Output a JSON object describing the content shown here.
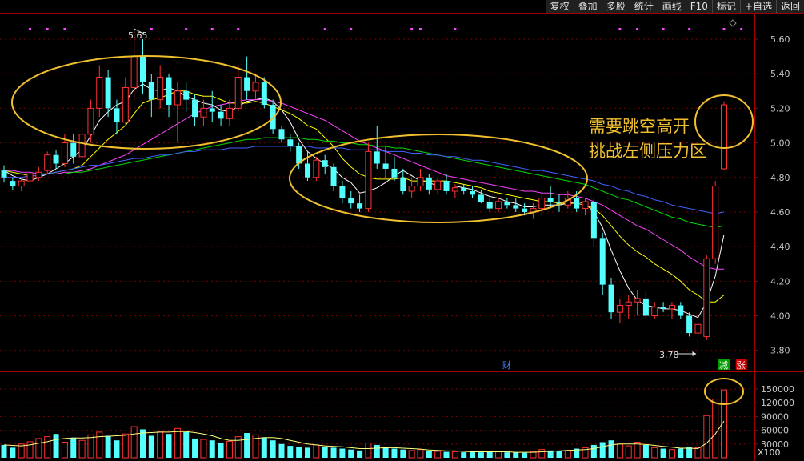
{
  "toolbar": {
    "buttons": [
      "复权",
      "叠加",
      "多股",
      "统计",
      "画线",
      "F10",
      "标记",
      "+自选",
      "返回"
    ]
  },
  "colors": {
    "up": "#ff3232",
    "down": "#54ffff",
    "flat": "#ffffff",
    "ma5": "#ffffff",
    "ma10": "#ffff00",
    "ma20": "#ff44ff",
    "ma30": "#00dd00",
    "ma60": "#4060ff",
    "annotation": "#f0c030",
    "grid": "#7a0000",
    "axis_text": "#c8c8c8",
    "marker": "#ff44ff"
  },
  "chart_data": [
    {
      "type": "candlestick",
      "ylim": [
        3.7,
        5.7
      ],
      "y_ticks": [
        "5.60",
        "5.40",
        "5.20",
        "5.00",
        "4.80",
        "4.60",
        "4.40",
        "4.20",
        "4.00",
        "3.80"
      ],
      "ohlc": [
        [
          4.84,
          4.87,
          4.77,
          4.8
        ],
        [
          4.78,
          4.8,
          4.73,
          4.75
        ],
        [
          4.75,
          4.8,
          4.72,
          4.78
        ],
        [
          4.78,
          4.85,
          4.76,
          4.82
        ],
        [
          4.8,
          4.86,
          4.78,
          4.83
        ],
        [
          4.84,
          4.95,
          4.82,
          4.93
        ],
        [
          4.93,
          4.96,
          4.85,
          4.88
        ],
        [
          4.88,
          5.05,
          4.86,
          5.0
        ],
        [
          5.0,
          5.05,
          4.88,
          4.92
        ],
        [
          4.92,
          5.1,
          4.9,
          5.05
        ],
        [
          5.05,
          5.25,
          5.0,
          5.2
        ],
        [
          5.2,
          5.45,
          5.15,
          5.38
        ],
        [
          5.38,
          5.42,
          5.15,
          5.2
        ],
        [
          5.2,
          5.25,
          5.05,
          5.12
        ],
        [
          5.12,
          5.38,
          5.1,
          5.32
        ],
        [
          5.32,
          5.66,
          5.25,
          5.5
        ],
        [
          5.5,
          5.6,
          5.28,
          5.35
        ],
        [
          5.35,
          5.4,
          5.15,
          5.25
        ],
        [
          5.25,
          5.45,
          5.2,
          5.38
        ],
        [
          5.38,
          5.4,
          5.15,
          5.22
        ],
        [
          5.22,
          5.35,
          5.0,
          5.3
        ],
        [
          5.3,
          5.35,
          5.18,
          5.25
        ],
        [
          5.25,
          5.28,
          5.1,
          5.15
        ],
        [
          5.15,
          5.25,
          5.1,
          5.2
        ],
        [
          5.2,
          5.3,
          5.12,
          5.18
        ],
        [
          5.18,
          5.22,
          5.1,
          5.14
        ],
        [
          5.14,
          5.25,
          5.1,
          5.2
        ],
        [
          5.2,
          5.45,
          5.18,
          5.38
        ],
        [
          5.38,
          5.5,
          5.25,
          5.3
        ],
        [
          5.3,
          5.4,
          5.25,
          5.35
        ],
        [
          5.35,
          5.38,
          5.2,
          5.22
        ],
        [
          5.22,
          5.25,
          5.05,
          5.08
        ],
        [
          5.08,
          5.1,
          5.0,
          5.02
        ],
        [
          5.02,
          5.05,
          4.95,
          4.98
        ],
        [
          4.98,
          5.0,
          4.85,
          4.88
        ],
        [
          4.88,
          4.95,
          4.78,
          4.8
        ],
        [
          4.8,
          4.92,
          4.78,
          4.9
        ],
        [
          4.9,
          4.93,
          4.82,
          4.86
        ],
        [
          4.86,
          4.88,
          4.72,
          4.75
        ],
        [
          4.75,
          4.78,
          4.65,
          4.68
        ],
        [
          4.68,
          4.72,
          4.62,
          4.65
        ],
        [
          4.65,
          4.7,
          4.6,
          4.62
        ],
        [
          4.62,
          5.0,
          4.6,
          4.95
        ],
        [
          4.95,
          5.1,
          4.85,
          4.88
        ],
        [
          4.88,
          4.98,
          4.8,
          4.85
        ],
        [
          4.85,
          4.92,
          4.78,
          4.8
        ],
        [
          4.8,
          4.85,
          4.7,
          4.72
        ],
        [
          4.72,
          4.8,
          4.68,
          4.75
        ],
        [
          4.75,
          4.85,
          4.72,
          4.8
        ],
        [
          4.8,
          4.82,
          4.7,
          4.73
        ],
        [
          4.73,
          4.8,
          4.7,
          4.78
        ],
        [
          4.78,
          4.82,
          4.7,
          4.72
        ],
        [
          4.72,
          4.76,
          4.68,
          4.74
        ],
        [
          4.74,
          4.76,
          4.7,
          4.72
        ],
        [
          4.72,
          4.75,
          4.68,
          4.7
        ],
        [
          4.7,
          4.73,
          4.65,
          4.66
        ],
        [
          4.66,
          4.68,
          4.6,
          4.62
        ],
        [
          4.62,
          4.68,
          4.6,
          4.66
        ],
        [
          4.66,
          4.68,
          4.62,
          4.64
        ],
        [
          4.64,
          4.68,
          4.6,
          4.62
        ],
        [
          4.62,
          4.65,
          4.58,
          4.6
        ],
        [
          4.6,
          4.65,
          4.56,
          4.62
        ],
        [
          4.62,
          4.72,
          4.58,
          4.68
        ],
        [
          4.68,
          4.75,
          4.62,
          4.66
        ],
        [
          4.66,
          4.7,
          4.6,
          4.64
        ],
        [
          4.64,
          4.72,
          4.62,
          4.68
        ],
        [
          4.68,
          4.72,
          4.6,
          4.62
        ],
        [
          4.62,
          4.68,
          4.58,
          4.66
        ],
        [
          4.66,
          4.68,
          4.4,
          4.45
        ],
        [
          4.45,
          4.48,
          4.12,
          4.18
        ],
        [
          4.18,
          4.22,
          3.98,
          4.02
        ],
        [
          4.02,
          4.1,
          3.96,
          4.06
        ],
        [
          4.06,
          4.12,
          3.98,
          4.08
        ],
        [
          4.08,
          4.15,
          4.0,
          4.1
        ],
        [
          4.1,
          4.14,
          3.98,
          4.0
        ],
        [
          4.0,
          4.08,
          3.98,
          4.05
        ],
        [
          4.05,
          4.08,
          4.02,
          4.04
        ],
        [
          4.04,
          4.08,
          3.98,
          4.06
        ],
        [
          4.06,
          4.08,
          3.98,
          4.0
        ],
        [
          4.0,
          4.02,
          3.88,
          3.9
        ],
        [
          3.9,
          3.98,
          3.78,
          3.95
        ],
        [
          3.88,
          4.35,
          3.86,
          4.33
        ],
        [
          4.33,
          4.78,
          4.3,
          4.75
        ],
        [
          4.85,
          5.24,
          4.84,
          5.22
        ]
      ],
      "ma": [
        {
          "name": "MA5",
          "values": [
            4.84,
            4.81,
            4.79,
            4.78,
            4.8,
            4.82,
            4.85,
            4.88,
            4.92,
            4.96,
            5.04,
            5.13,
            5.18,
            5.22,
            5.24,
            5.31,
            5.34,
            5.31,
            5.3,
            5.32,
            5.3,
            5.27,
            5.25,
            5.23,
            5.22,
            5.19,
            5.18,
            5.21,
            5.24,
            5.25,
            5.26,
            5.24,
            5.19,
            5.12,
            5.02,
            4.95,
            4.91,
            4.88,
            4.85,
            4.8,
            4.77,
            4.71,
            4.72,
            4.74,
            4.77,
            4.81,
            4.84,
            4.81,
            4.78,
            4.77,
            4.75,
            4.75,
            4.75,
            4.74,
            4.73,
            4.71,
            4.69,
            4.68,
            4.66,
            4.65,
            4.63,
            4.63,
            4.64,
            4.64,
            4.64,
            4.65,
            4.66,
            4.65,
            4.6,
            4.51,
            4.38,
            4.26,
            4.16,
            4.09,
            4.06,
            4.05,
            4.04,
            4.04,
            4.03,
            4.01,
            3.99,
            4.08,
            4.23,
            4.47
          ]
        },
        {
          "name": "MA10",
          "values": [
            4.84,
            4.83,
            4.82,
            4.81,
            4.81,
            4.82,
            4.83,
            4.84,
            4.85,
            4.87,
            4.92,
            4.97,
            5.02,
            5.06,
            5.1,
            5.17,
            5.23,
            5.25,
            5.26,
            5.28,
            5.3,
            5.3,
            5.28,
            5.27,
            5.27,
            5.25,
            5.23,
            5.23,
            5.23,
            5.24,
            5.23,
            5.21,
            5.19,
            5.17,
            5.14,
            5.1,
            5.08,
            5.03,
            4.98,
            4.91,
            4.86,
            4.82,
            4.8,
            4.79,
            4.79,
            4.79,
            4.8,
            4.78,
            4.78,
            4.78,
            4.78,
            4.78,
            4.77,
            4.76,
            4.75,
            4.74,
            4.72,
            4.71,
            4.7,
            4.69,
            4.68,
            4.67,
            4.66,
            4.66,
            4.65,
            4.65,
            4.65,
            4.64,
            4.62,
            4.58,
            4.52,
            4.46,
            4.41,
            4.37,
            4.34,
            4.3,
            4.27,
            4.24,
            4.2,
            4.15,
            4.12,
            4.08,
            4.08,
            4.12
          ]
        },
        {
          "name": "MA20",
          "values": [
            4.84,
            4.84,
            4.83,
            4.83,
            4.82,
            4.82,
            4.82,
            4.83,
            4.83,
            4.84,
            4.85,
            4.87,
            4.89,
            4.91,
            4.93,
            4.96,
            4.99,
            5.02,
            5.05,
            5.08,
            5.11,
            5.14,
            5.17,
            5.19,
            5.21,
            5.22,
            5.23,
            5.24,
            5.25,
            5.25,
            5.25,
            5.24,
            5.23,
            5.21,
            5.19,
            5.17,
            5.15,
            5.13,
            5.1,
            5.07,
            5.04,
            5.01,
            4.99,
            4.97,
            4.95,
            4.93,
            4.91,
            4.89,
            4.87,
            4.85,
            4.83,
            4.81,
            4.8,
            4.79,
            4.78,
            4.77,
            4.76,
            4.75,
            4.74,
            4.73,
            4.72,
            4.72,
            4.71,
            4.71,
            4.7,
            4.7,
            4.69,
            4.68,
            4.66,
            4.64,
            4.61,
            4.58,
            4.55,
            4.52,
            4.5,
            4.47,
            4.44,
            4.41,
            4.38,
            4.34,
            4.31,
            4.28,
            4.27,
            4.27
          ]
        },
        {
          "name": "MA30",
          "values": [
            4.82,
            4.82,
            4.82,
            4.82,
            4.82,
            4.82,
            4.82,
            4.82,
            4.83,
            4.83,
            4.84,
            4.85,
            4.86,
            4.87,
            4.88,
            4.89,
            4.9,
            4.91,
            4.92,
            4.93,
            4.94,
            4.95,
            4.96,
            4.97,
            4.98,
            4.99,
            5.0,
            5.01,
            5.02,
            5.02,
            5.03,
            5.03,
            5.03,
            5.03,
            5.03,
            5.02,
            5.02,
            5.01,
            5.01,
            5.0,
            5.0,
            4.99,
            4.99,
            4.98,
            4.98,
            4.97,
            4.97,
            4.96,
            4.95,
            4.94,
            4.93,
            4.92,
            4.91,
            4.9,
            4.89,
            4.88,
            4.87,
            4.86,
            4.85,
            4.84,
            4.83,
            4.82,
            4.81,
            4.8,
            4.79,
            4.78,
            4.77,
            4.76,
            4.74,
            4.72,
            4.7,
            4.68,
            4.67,
            4.65,
            4.63,
            4.61,
            4.59,
            4.57,
            4.56,
            4.54,
            4.53,
            4.52,
            4.51,
            4.52
          ]
        },
        {
          "name": "MA60",
          "values": [
            4.8,
            4.8,
            4.8,
            4.81,
            4.81,
            4.82,
            4.83,
            4.84,
            4.85,
            4.86,
            4.87,
            4.87,
            4.88,
            4.89,
            4.9,
            4.91,
            4.91,
            4.92,
            4.93,
            4.93,
            4.94,
            4.95,
            4.95,
            4.96,
            4.96,
            4.96,
            4.97,
            4.97,
            4.97,
            4.98,
            4.98,
            4.98,
            4.98,
            4.98,
            4.98,
            4.98,
            4.97,
            4.97,
            4.97,
            4.97,
            4.96,
            4.96,
            4.96,
            4.96,
            4.95,
            4.95,
            4.95,
            4.94,
            4.94,
            4.93,
            4.93,
            4.92,
            4.92,
            4.91,
            4.9,
            4.9,
            4.89,
            4.88,
            4.87,
            4.86,
            4.85,
            4.84,
            4.84,
            4.83,
            4.82,
            4.81,
            4.8,
            4.79,
            4.78,
            4.76,
            4.75,
            4.73,
            4.72,
            4.7,
            4.69,
            4.67,
            4.66,
            4.64,
            4.63,
            4.62,
            4.61,
            4.6,
            4.59,
            4.6
          ]
        }
      ],
      "high_label": "5.65",
      "low_label": "3.78",
      "event_labels": [
        {
          "text": "财",
          "index": 58
        },
        {
          "text": "减",
          "index": 83
        },
        {
          "text": "涨",
          "index": 85
        }
      ],
      "annotations": {
        "text_line1": "需要跳空高开",
        "text_line2": "挑战左侧压力区"
      }
    },
    {
      "type": "bar",
      "ylim": [
        0,
        165000
      ],
      "y_ticks": [
        "150000",
        "120000",
        "90000",
        "60000",
        "30000"
      ],
      "unit_label": "X100",
      "volume": [
        28000,
        22000,
        30000,
        35000,
        42000,
        46000,
        52000,
        34000,
        44000,
        38000,
        50000,
        56000,
        48000,
        38000,
        52000,
        68000,
        62000,
        48000,
        58000,
        52000,
        64000,
        56000,
        42000,
        40000,
        38000,
        32000,
        36000,
        46000,
        54000,
        50000,
        44000,
        38000,
        30000,
        26000,
        24000,
        22000,
        28000,
        24000,
        22000,
        20000,
        18000,
        16000,
        32000,
        28000,
        24000,
        20000,
        18000,
        16000,
        18000,
        15000,
        14000,
        13000,
        13000,
        12000,
        13000,
        12000,
        14000,
        13000,
        12000,
        12000,
        11000,
        14000,
        18000,
        16000,
        14000,
        16000,
        20000,
        22000,
        28000,
        34000,
        38000,
        30000,
        26000,
        34000,
        28000,
        22000,
        20000,
        18000,
        20000,
        24000,
        22000,
        92000,
        128000,
        148000
      ],
      "ma_volume": [
        28000,
        27000,
        26000,
        28000,
        32000,
        35000,
        40000,
        42000,
        43000,
        43000,
        44000,
        46000,
        47000,
        48000,
        49000,
        52000,
        54000,
        55000,
        56000,
        56000,
        57000,
        57000,
        55000,
        52000,
        48000,
        42000,
        38000,
        38000,
        40000,
        42000,
        44000,
        44000,
        42000,
        38000,
        34000,
        30000,
        28000,
        26000,
        25000,
        24000,
        22000,
        20000,
        20000,
        21000,
        22000,
        22000,
        21000,
        20000,
        19000,
        17000,
        16000,
        15000,
        15000,
        14000,
        13000,
        13000,
        13000,
        13000,
        13000,
        12000,
        12000,
        12000,
        13000,
        14000,
        15000,
        16000,
        17000,
        18000,
        20000,
        24000,
        28000,
        30000,
        30000,
        30000,
        29000,
        27000,
        25000,
        23000,
        21000,
        21000,
        20000,
        32000,
        52000,
        80000
      ]
    }
  ]
}
